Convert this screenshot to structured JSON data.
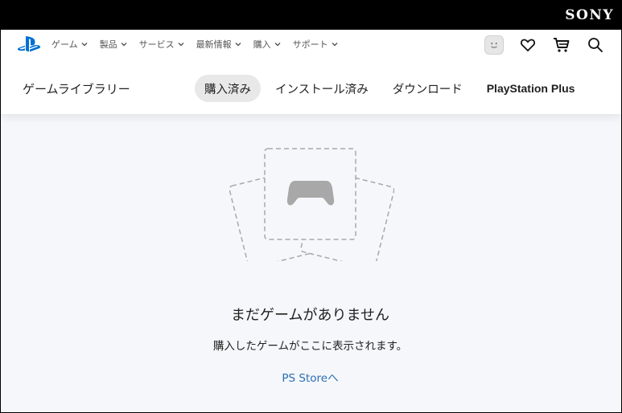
{
  "brand": {
    "corporate": "SONY"
  },
  "nav": {
    "items": [
      {
        "label": "ゲーム"
      },
      {
        "label": "製品"
      },
      {
        "label": "サービス"
      },
      {
        "label": "最新情報"
      },
      {
        "label": "購入"
      },
      {
        "label": "サポート"
      }
    ]
  },
  "header_icons": [
    "avatar-icon",
    "wishlist-heart-icon",
    "cart-icon",
    "search-icon"
  ],
  "library": {
    "title": "ゲームライブラリー",
    "tabs": [
      {
        "label": "購入済み",
        "active": true
      },
      {
        "label": "インストール済み",
        "active": false
      },
      {
        "label": "ダウンロード",
        "active": false
      },
      {
        "label": "PlayStation Plus",
        "active": false
      }
    ]
  },
  "empty_state": {
    "title": "まだゲームがありません",
    "description": "購入したゲームがここに表示されます。",
    "link": "PS Storeへ"
  },
  "colors": {
    "link": "#2a6fb3",
    "ps_blue": "#0070d1",
    "background": "#f5f7fa"
  }
}
